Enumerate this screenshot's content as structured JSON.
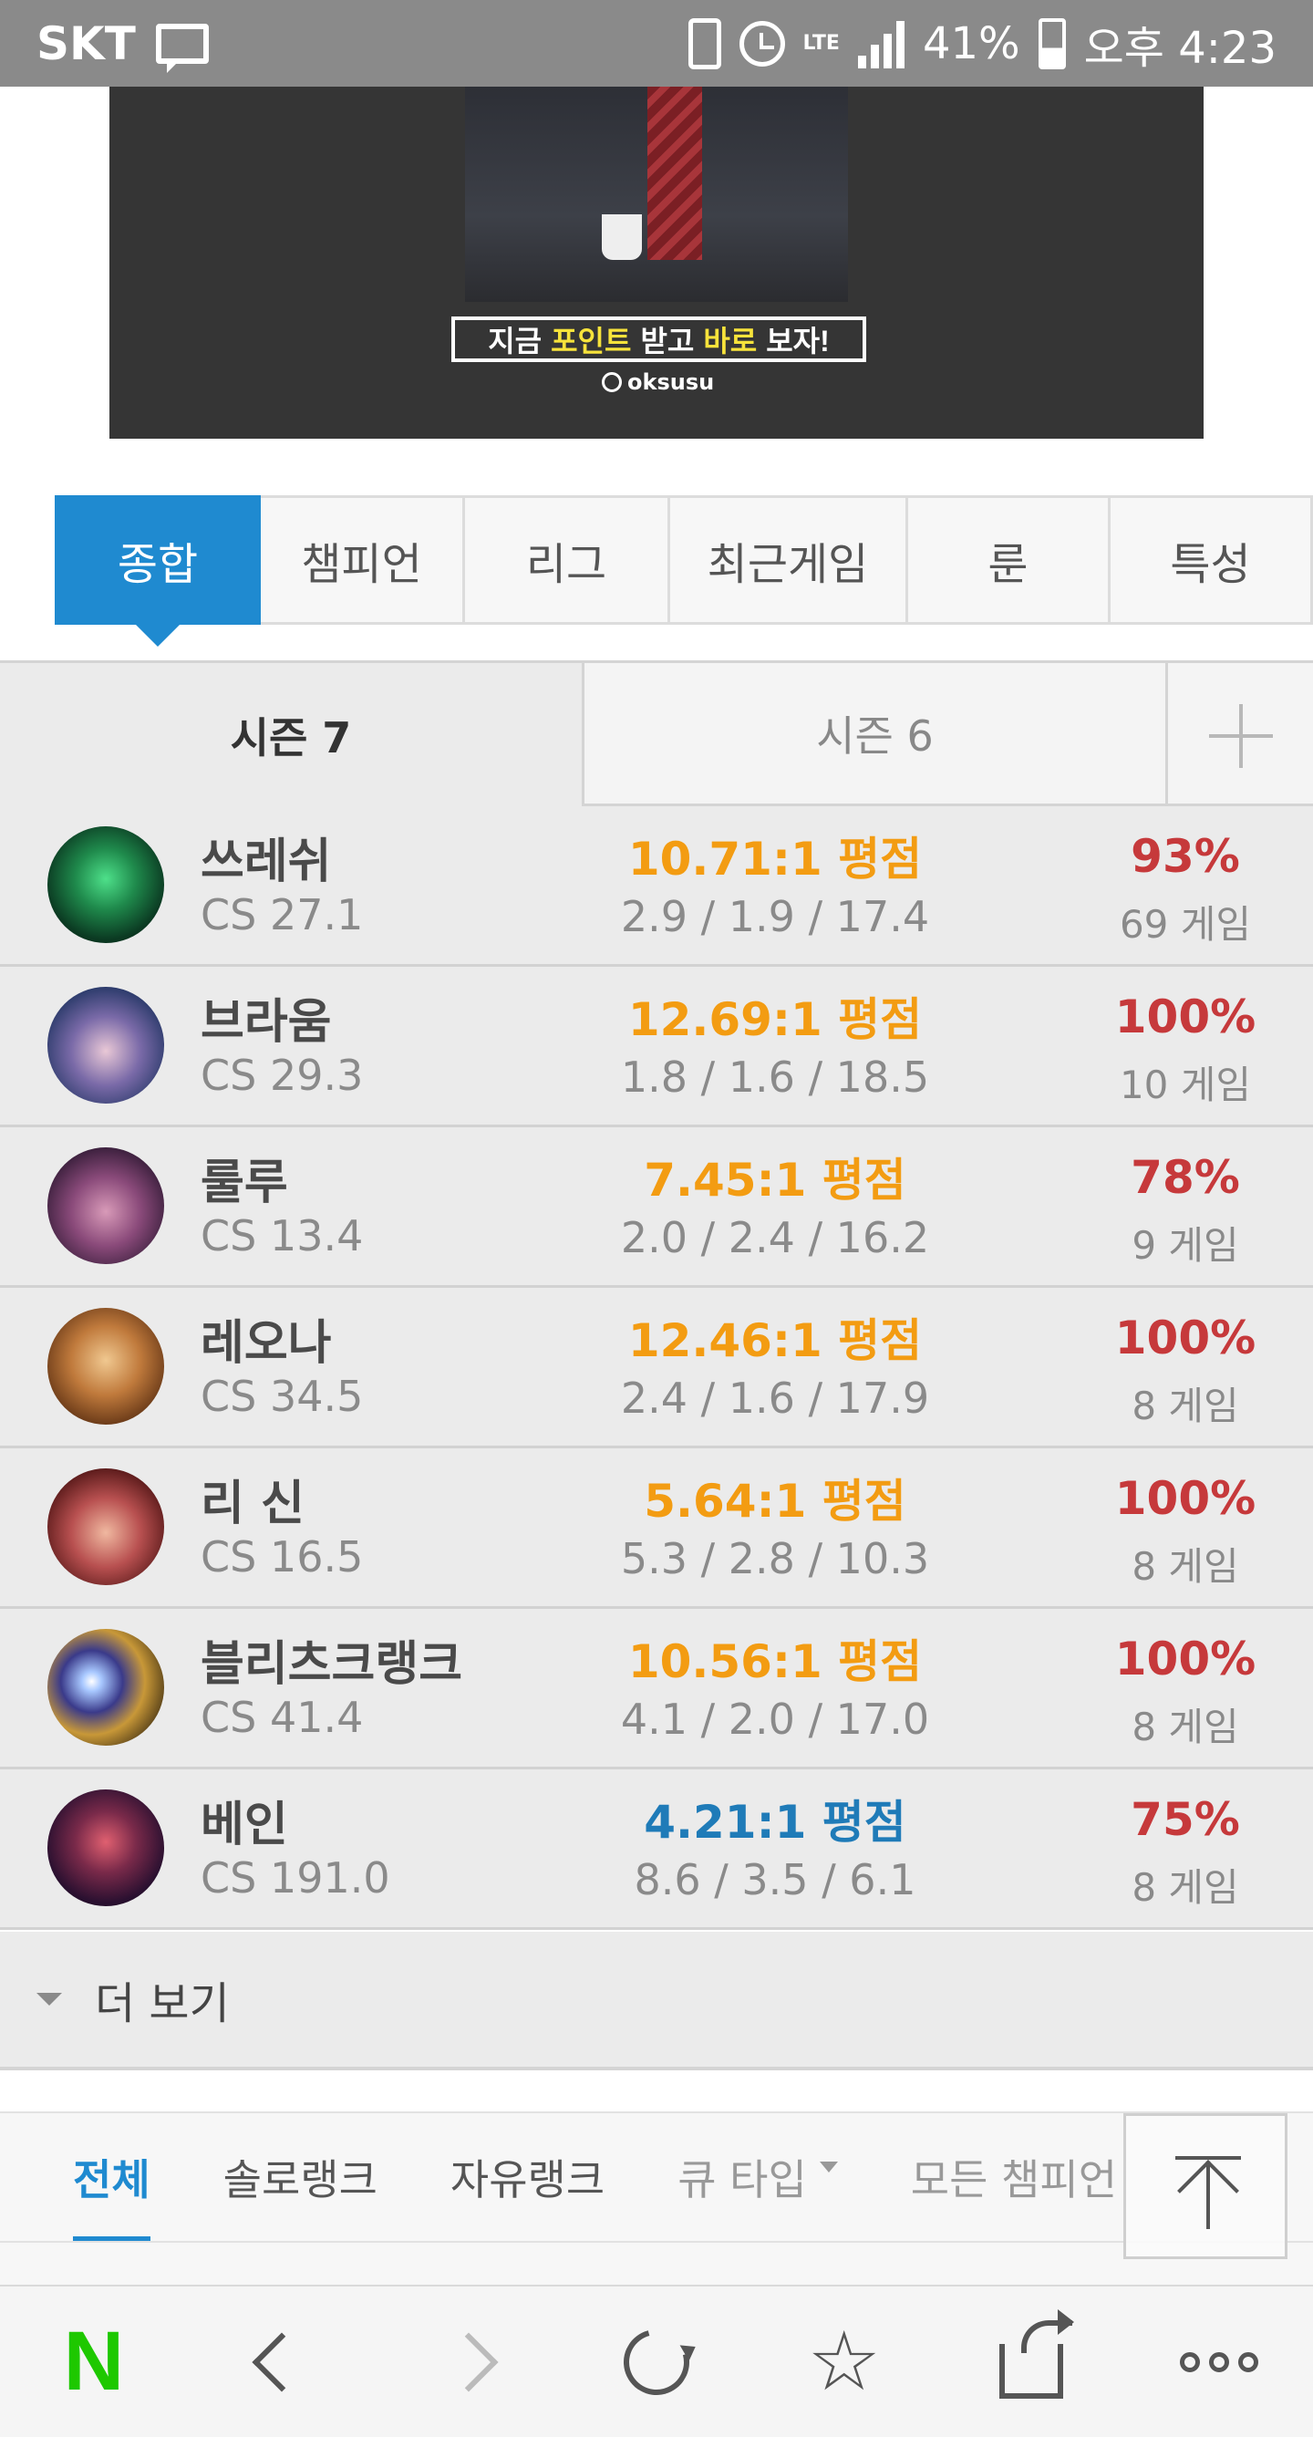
{
  "status_bar": {
    "carrier": "SKT",
    "battery": "41%",
    "time": "오후 4:23",
    "lte": "LTE",
    "icons": [
      "message-icon",
      "vibrate-icon",
      "alarm-icon",
      "lte-icon",
      "signal-icon",
      "battery-icon"
    ]
  },
  "ad": {
    "cta": [
      "지금",
      "포인트",
      "받고",
      "바로",
      "보자!"
    ],
    "brand": "oksusu",
    "accent": "#f7e33b"
  },
  "main_tabs": [
    {
      "label": "종합",
      "active": true
    },
    {
      "label": "챔피언"
    },
    {
      "label": "리그"
    },
    {
      "label": "최근게임"
    },
    {
      "label": "룬"
    },
    {
      "label": "특성"
    }
  ],
  "season_tabs": [
    {
      "label": "시즌 7",
      "active": true
    },
    {
      "label": "시즌 6"
    }
  ],
  "champions": [
    {
      "name": "쓰레쉬",
      "cs": "CS 27.1",
      "ratio": "10.71:1 평점",
      "kda": "2.9 / 1.9 / 17.4",
      "winrate": "93%",
      "games": "69 게임",
      "ratio_color": "#f39c12"
    },
    {
      "name": "브라움",
      "cs": "CS 29.3",
      "ratio": "12.69:1 평점",
      "kda": "1.8 / 1.6 / 18.5",
      "winrate": "100%",
      "games": "10 게임",
      "ratio_color": "#f39c12"
    },
    {
      "name": "룰루",
      "cs": "CS 13.4",
      "ratio": "7.45:1 평점",
      "kda": "2.0 / 2.4 / 16.2",
      "winrate": "78%",
      "games": "9 게임",
      "ratio_color": "#f39c12"
    },
    {
      "name": "레오나",
      "cs": "CS 34.5",
      "ratio": "12.46:1 평점",
      "kda": "2.4 / 1.6 / 17.9",
      "winrate": "100%",
      "games": "8 게임",
      "ratio_color": "#f39c12"
    },
    {
      "name": "리 신",
      "cs": "CS 16.5",
      "ratio": "5.64:1 평점",
      "kda": "5.3 / 2.8 / 10.3",
      "winrate": "100%",
      "games": "8 게임",
      "ratio_color": "#f39c12"
    },
    {
      "name": "블리츠크랭크",
      "cs": "CS 41.4",
      "ratio": "10.56:1 평점",
      "kda": "4.1 / 2.0 / 17.0",
      "winrate": "100%",
      "games": "8 게임",
      "ratio_color": "#f39c12"
    },
    {
      "name": "베인",
      "cs": "CS 191.0",
      "ratio": "4.21:1 평점",
      "kda": "8.6 / 3.5 / 6.1",
      "winrate": "75%",
      "games": "8 게임",
      "ratio_color": "#1f7bb8"
    }
  ],
  "more_label": "더 보기",
  "queue_tabs": [
    {
      "label": "전체",
      "active": true
    },
    {
      "label": "솔로랭크"
    },
    {
      "label": "자유랭크"
    },
    {
      "label": "큐 타입",
      "dropdown": true
    },
    {
      "label": "모든 챔피언"
    }
  ],
  "colors": {
    "accent": "#1f8ad0",
    "rating_orange": "#f39c12",
    "rating_blue": "#1f7bb8",
    "winrate_red": "#c6393b",
    "naver_green": "#1ec800"
  },
  "toolbar": {
    "logo": "N",
    "icons": [
      "naver-home-icon",
      "back-icon",
      "forward-icon",
      "refresh-icon",
      "bookmark-star-icon",
      "share-icon",
      "more-icon"
    ],
    "star": "☆"
  }
}
